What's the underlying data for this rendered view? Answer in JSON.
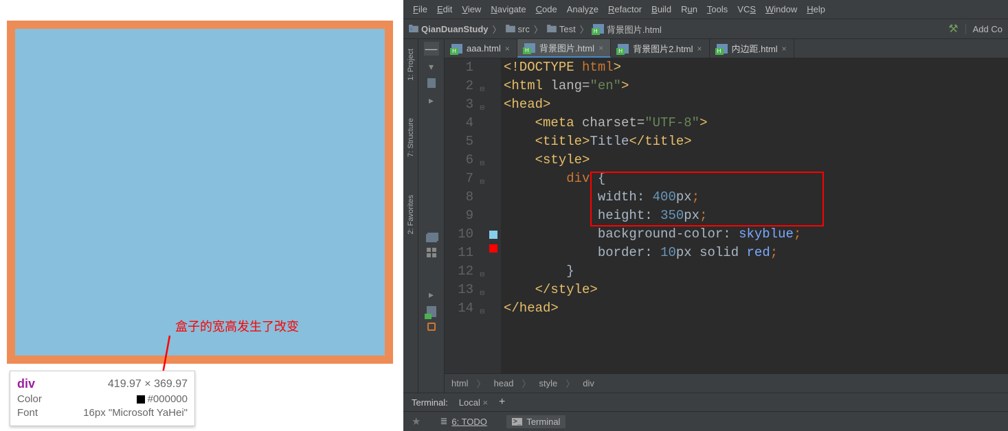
{
  "left": {
    "annotation": "盒子的宽高发生了改变",
    "tooltip": {
      "tag": "div",
      "dimensions": "419.97 × 369.97",
      "color_label": "Color",
      "color_value": "#000000",
      "font_label": "Font",
      "font_value": "16px \"Microsoft YaHei\""
    }
  },
  "ide": {
    "menu": [
      "File",
      "Edit",
      "View",
      "Navigate",
      "Code",
      "Analyze",
      "Refactor",
      "Build",
      "Run",
      "Tools",
      "VCS",
      "Window",
      "Help"
    ],
    "nav": {
      "project": "QianDuanStudy",
      "folder1": "src",
      "folder2": "Test",
      "file": "背景图片.html",
      "add": "Add Co"
    },
    "side_tabs": {
      "project": "1: Project",
      "structure": "7: Structure",
      "favorites": "2: Favorites"
    },
    "tabs": [
      {
        "name": "aaa.html",
        "active": false
      },
      {
        "name": "背景图片.html",
        "active": true
      },
      {
        "name": "背景图片2.html",
        "active": false
      },
      {
        "name": "内边距.html",
        "active": false
      }
    ],
    "lines": [
      "1",
      "2",
      "3",
      "4",
      "5",
      "6",
      "7",
      "8",
      "9",
      "10",
      "11",
      "12",
      "13",
      "14"
    ],
    "code": {
      "l1_a": "<!DOCTYPE ",
      "l1_b": "html",
      "l1_c": ">",
      "l2_a": "<html ",
      "l2_b": "lang=",
      "l2_c": "\"en\"",
      "l2_d": ">",
      "l3": "<head>",
      "l4_a": "<meta ",
      "l4_b": "charset=",
      "l4_c": "\"UTF-8\"",
      "l4_d": ">",
      "l5_a": "<title>",
      "l5_b": "Title",
      "l5_c": "</title>",
      "l6": "<style>",
      "l7_a": "div ",
      "l7_b": "{",
      "l8_a": "width",
      "l8_b": ": ",
      "l8_c": "400",
      "l8_d": "px",
      "l8_e": ";",
      "l9_a": "height",
      "l9_b": ": ",
      "l9_c": "350",
      "l9_d": "px",
      "l9_e": ";",
      "l10_a": "background-color",
      "l10_b": ": ",
      "l10_c": "skyblue",
      "l10_d": ";",
      "l11_a": "border",
      "l11_b": ": ",
      "l11_c": "10",
      "l11_d": "px ",
      "l11_e": "solid ",
      "l11_f": "red",
      "l11_g": ";",
      "l12": "}",
      "l13": "</style>",
      "l14": "</head>"
    },
    "breadcrumb": [
      "html",
      "head",
      "style",
      "div"
    ],
    "terminal": {
      "label": "Terminal:",
      "tab": "Local"
    },
    "bottom": {
      "todo": "6: TODO",
      "terminal": "Terminal"
    }
  }
}
